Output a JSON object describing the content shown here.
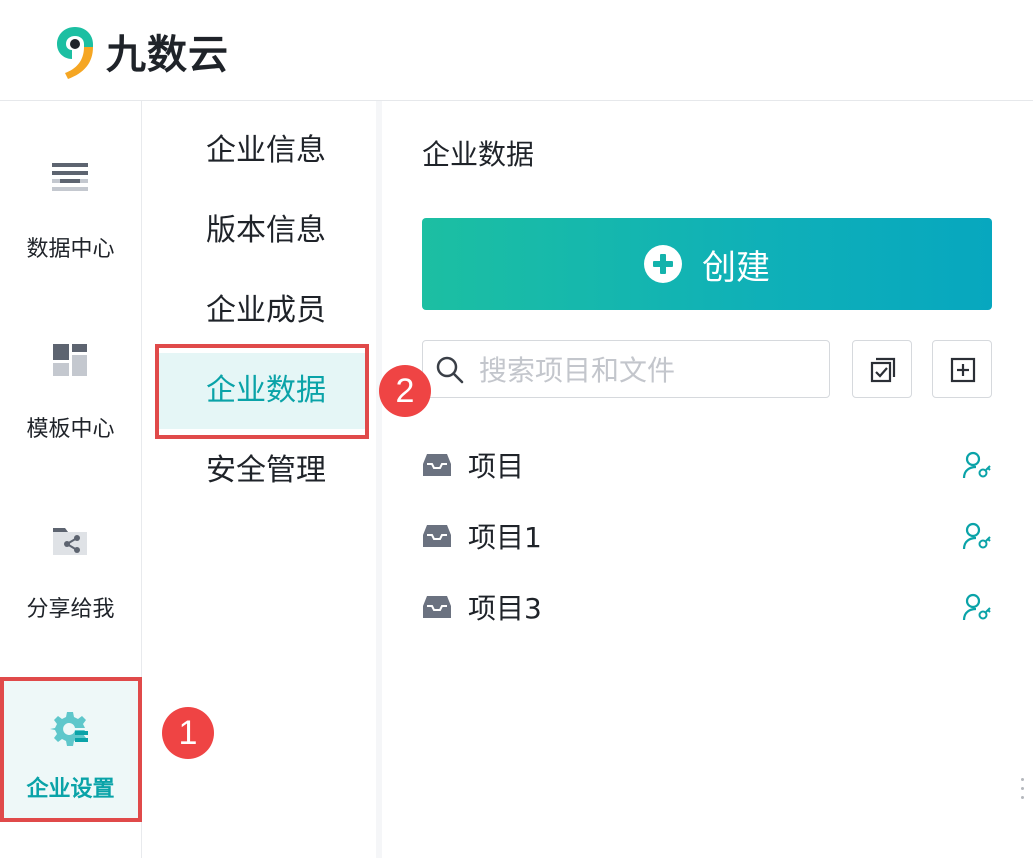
{
  "app": {
    "brand_name": "九数云",
    "brand_colors": [
      "#f5a623",
      "#1cbfa2",
      "#1f2329"
    ]
  },
  "left_nav": {
    "items": [
      {
        "label": "数据中心",
        "icon": "list-icon",
        "active": false
      },
      {
        "label": "模板中心",
        "icon": "template-grid-icon",
        "active": false
      },
      {
        "label": "分享给我",
        "icon": "shared-folder-icon",
        "active": false
      },
      {
        "label": "企业设置",
        "icon": "gear-settings-icon",
        "active": true
      }
    ]
  },
  "sub_nav": {
    "items": [
      {
        "label": "企业信息",
        "active": false
      },
      {
        "label": "版本信息",
        "active": false
      },
      {
        "label": "企业成员",
        "active": false
      },
      {
        "label": "企业数据",
        "active": true
      },
      {
        "label": "安全管理",
        "active": false
      }
    ]
  },
  "main": {
    "title": "企业数据",
    "create_button": {
      "label": "创建"
    },
    "search": {
      "placeholder": "搜索项目和文件",
      "value": ""
    },
    "projects": [
      {
        "name": "项目"
      },
      {
        "name": "项目1"
      },
      {
        "name": "项目3"
      }
    ]
  },
  "annotations": {
    "badge_1": "1",
    "badge_2": "2"
  },
  "accent_color": "#0aa3a8",
  "annotation_color": "#e04a4a"
}
